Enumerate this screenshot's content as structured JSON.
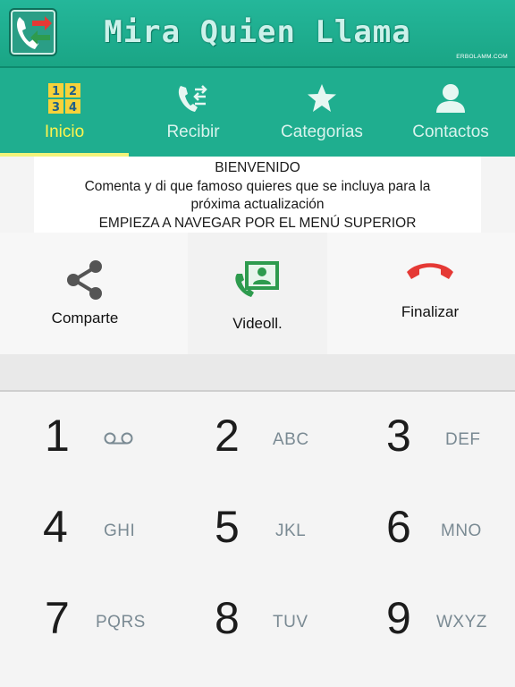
{
  "header": {
    "title": "Mira  Quien  Llama",
    "credit": "ERBOLAMM.COM",
    "logo_icon": "phone-swap-icon"
  },
  "tabs": [
    {
      "label": "Inicio",
      "icon": "grid-1234-icon",
      "active": true
    },
    {
      "label": "Recibir",
      "icon": "incoming-call-icon",
      "active": false
    },
    {
      "label": "Categorias",
      "icon": "star-icon",
      "active": false
    },
    {
      "label": "Contactos",
      "icon": "person-icon",
      "active": false
    }
  ],
  "welcome": {
    "line1": "BIENVENIDO",
    "line2": "Comenta y di que famoso quieres que se incluya para la",
    "line3": "próxima actualización",
    "line4": "EMPIEZA A NAVEGAR POR EL MENÚ SUPERIOR"
  },
  "actions": {
    "share": {
      "label": "Comparte",
      "icon": "share-icon"
    },
    "video": {
      "label": "Videoll.",
      "icon": "video-contact-icon"
    },
    "end": {
      "label": "Finalizar",
      "icon": "end-call-icon"
    }
  },
  "dialpad": {
    "keys": [
      {
        "digit": "1",
        "letters": ""
      },
      {
        "digit": "2",
        "letters": "ABC"
      },
      {
        "digit": "3",
        "letters": "DEF"
      },
      {
        "digit": "4",
        "letters": "GHI"
      },
      {
        "digit": "5",
        "letters": "JKL"
      },
      {
        "digit": "6",
        "letters": "MNO"
      },
      {
        "digit": "7",
        "letters": "PQRS"
      },
      {
        "digit": "8",
        "letters": "TUV"
      },
      {
        "digit": "9",
        "letters": "WXYZ"
      }
    ]
  },
  "colors": {
    "header": "#1fae8f",
    "active_tab": "#fff44d",
    "end_call": "#e53935",
    "video": "#2e9b4e"
  }
}
